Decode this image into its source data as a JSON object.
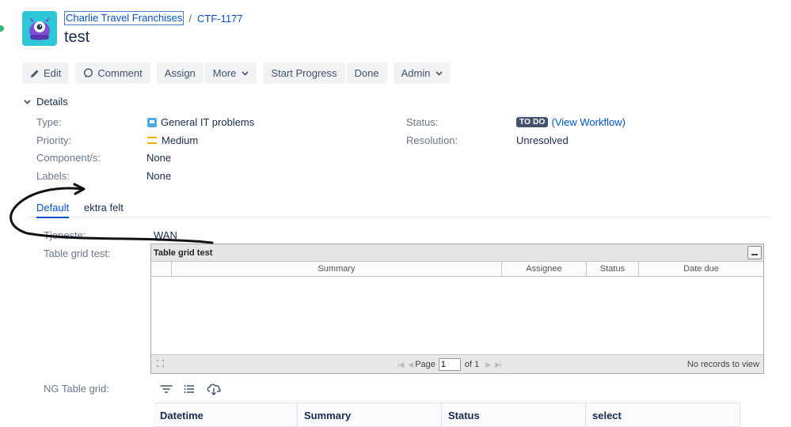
{
  "breadcrumb": {
    "project": "Charlie Travel Franchises",
    "separator": "/",
    "issue_key": "CTF-1177"
  },
  "issue": {
    "title": "test"
  },
  "toolbar": {
    "edit": "Edit",
    "comment": "Comment",
    "assign": "Assign",
    "more": "More",
    "start_progress": "Start Progress",
    "done": "Done",
    "admin": "Admin"
  },
  "details": {
    "heading": "Details",
    "type_label": "Type:",
    "type_value": "General IT problems",
    "priority_label": "Priority:",
    "priority_value": "Medium",
    "components_label": "Component/s:",
    "components_value": "None",
    "labels_label": "Labels:",
    "labels_value": "None",
    "status_label": "Status:",
    "status_value": "TO DO",
    "workflow_link": "(View Workflow)",
    "resolution_label": "Resolution:",
    "resolution_value": "Unresolved"
  },
  "tabs": {
    "default": "Default",
    "ekstra": "ektra felt"
  },
  "fields": {
    "tjeneste_label": "Tjeneste:",
    "tjeneste_value": "WAN",
    "grid_label": "Table grid test:",
    "ng_label": "NG Table grid:"
  },
  "grid": {
    "title": "Table grid test",
    "columns": [
      "",
      "Summary",
      "Assignee",
      "Status",
      "Date due"
    ],
    "page_label": "Page",
    "page_value": "1",
    "of_label": "of 1",
    "no_records": "No records to view"
  },
  "ng_table": {
    "columns": [
      "Datetime",
      "Summary",
      "Status",
      "select"
    ]
  },
  "colors": {
    "link": "#0052cc",
    "avatar": "#2ec7d8",
    "lozenge": "#42526e",
    "priority": "#ffab00"
  }
}
